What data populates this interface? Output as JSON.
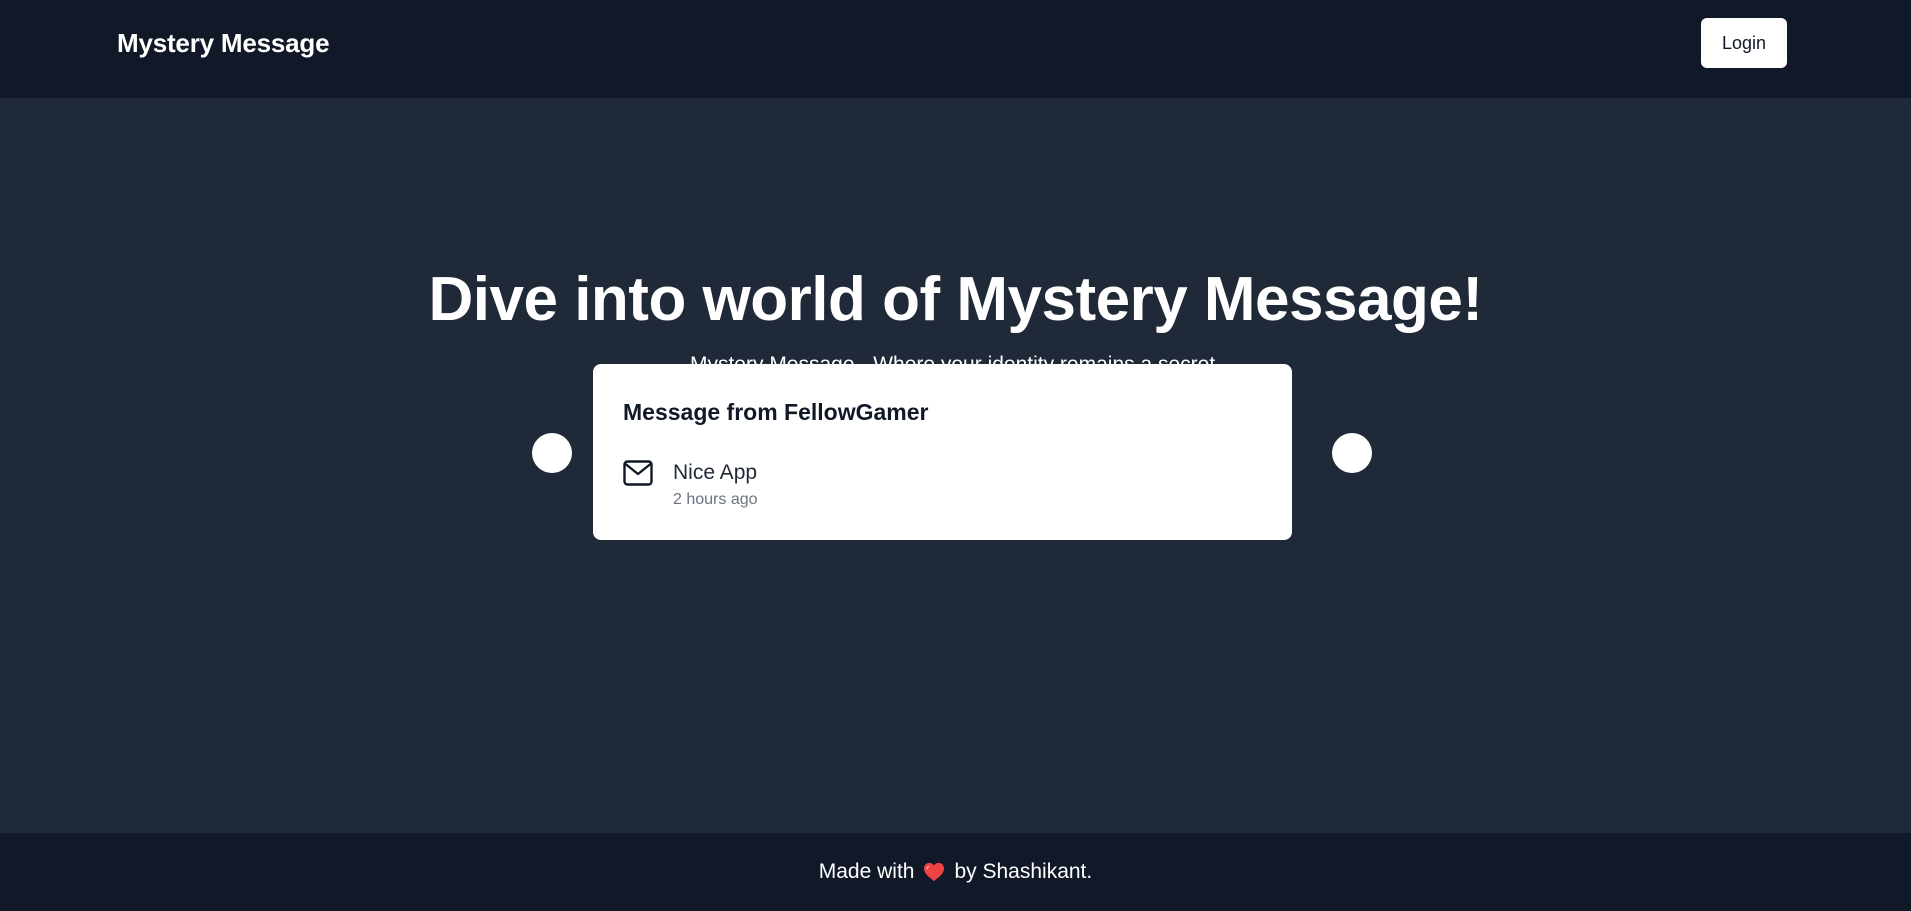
{
  "navbar": {
    "brand": "Mystery Message",
    "login_label": "Login"
  },
  "hero": {
    "title": "Dive into world of Mystery Message!",
    "subtitle": "Mystery Message - Where your identity remains a secret."
  },
  "carousel": {
    "card": {
      "title": "Message from FellowGamer",
      "icon": "mail-icon",
      "message": "Nice App",
      "time": "2 hours ago"
    },
    "prev_icon": "chevron-left-icon",
    "next_icon": "chevron-right-icon"
  },
  "footer": {
    "prefix": "Made with",
    "icon": "heart-icon",
    "suffix": "by Shashikant."
  },
  "colors": {
    "navbar_bg": "#111827",
    "hero_bg": "#1f2937",
    "card_bg": "#ffffff",
    "heart": "#ef4444"
  }
}
